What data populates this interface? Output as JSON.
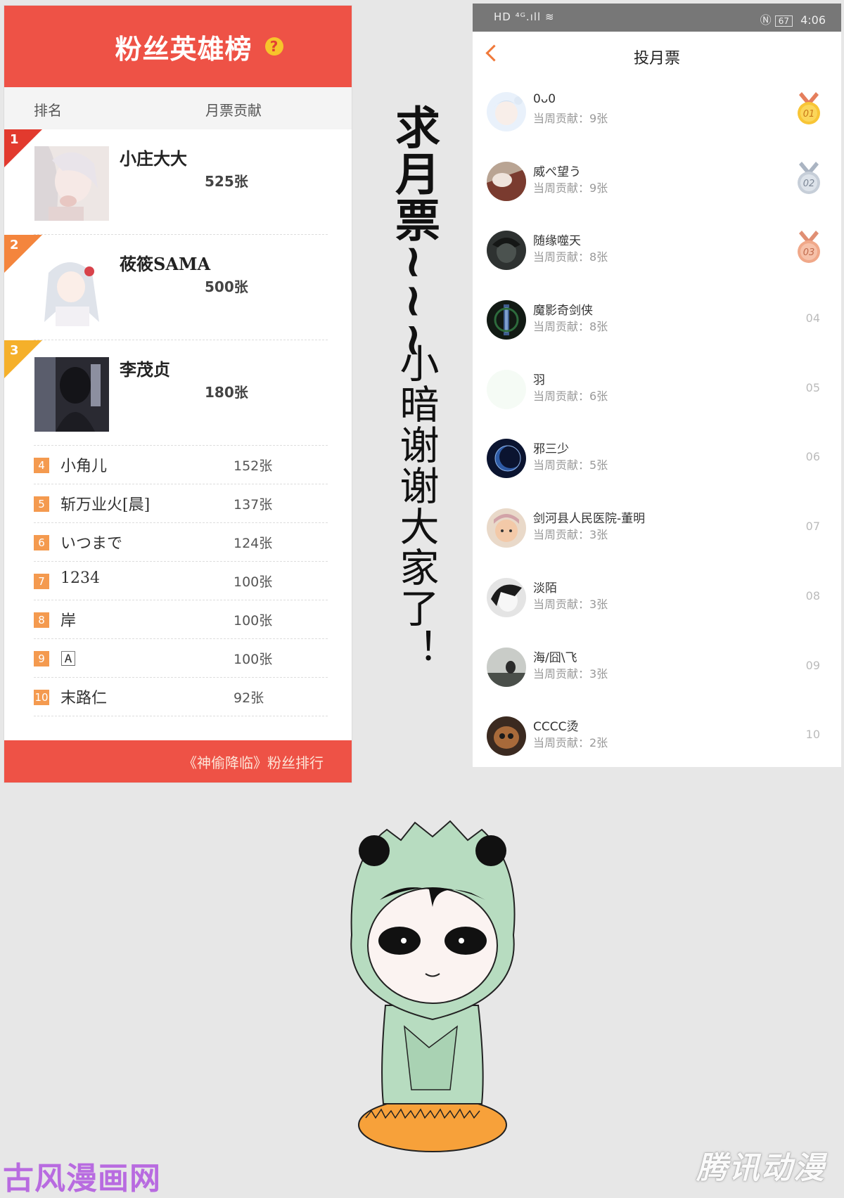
{
  "left_panel": {
    "title": "粉丝英雄榜",
    "help_icon": "?",
    "col_rank": "排名",
    "col_votes": "月票贡献",
    "top": [
      {
        "rank": "1",
        "name": "小庄大大",
        "votes": "525张",
        "ribbon_color": "#e23a2e"
      },
      {
        "rank": "2",
        "name": "莜筱SAMA",
        "votes": "500张",
        "ribbon_color": "#f4853d"
      },
      {
        "rank": "3",
        "name": "李茂贞",
        "votes": "180张",
        "ribbon_color": "#f5b02a"
      }
    ],
    "list": [
      {
        "rank": "4",
        "name": "小角儿",
        "votes": "152张"
      },
      {
        "rank": "5",
        "name": "斩万业火[晨]",
        "votes": "137张"
      },
      {
        "rank": "6",
        "name": "いつまで",
        "votes": "124张"
      },
      {
        "rank": "7",
        "name": "1234",
        "votes": "100张"
      },
      {
        "rank": "8",
        "name": "岸",
        "votes": "100张"
      },
      {
        "rank": "9",
        "name": "🄰",
        "votes": "100张"
      },
      {
        "rank": "10",
        "name": "末路仁",
        "votes": "92张"
      }
    ],
    "footer": "《神偷降临》粉丝排行"
  },
  "right_panel": {
    "status_left": "HD ⁴ᴳ.ıll ≋",
    "status_time": "4:06",
    "battery": "67",
    "title": "投月票",
    "fans": [
      {
        "name": "0ᴗ0",
        "votes": "当周贡献：9张",
        "rank": "01",
        "medal": "gold"
      },
      {
        "name": "威ぺ望う",
        "votes": "当周贡献：9张",
        "rank": "02",
        "medal": "silver"
      },
      {
        "name": "随缘噬天",
        "votes": "当周贡献：8张",
        "rank": "03",
        "medal": "bronze"
      },
      {
        "name": "魔影奇剑侠",
        "votes": "当周贡献：8张",
        "rank": "04"
      },
      {
        "name": "羽",
        "votes": "当周贡献：6张",
        "rank": "05"
      },
      {
        "name": "邪三少",
        "votes": "当周贡献：5张",
        "rank": "06"
      },
      {
        "name": "剑河县人民医院-董明",
        "votes": "当周贡献：3张",
        "rank": "07"
      },
      {
        "name": "淡陌",
        "votes": "当周贡献：3张",
        "rank": "08"
      },
      {
        "name": "海/囧\\飞",
        "votes": "当周贡献：3张",
        "rank": "09"
      },
      {
        "name": "CCCC烫",
        "votes": "当周贡献：2张",
        "rank": "10"
      }
    ]
  },
  "side_text": "求月票~~~",
  "side_text2": "小暗谢谢大家了！",
  "watermark_left": "古风漫画网",
  "watermark_right": "腾讯动漫"
}
